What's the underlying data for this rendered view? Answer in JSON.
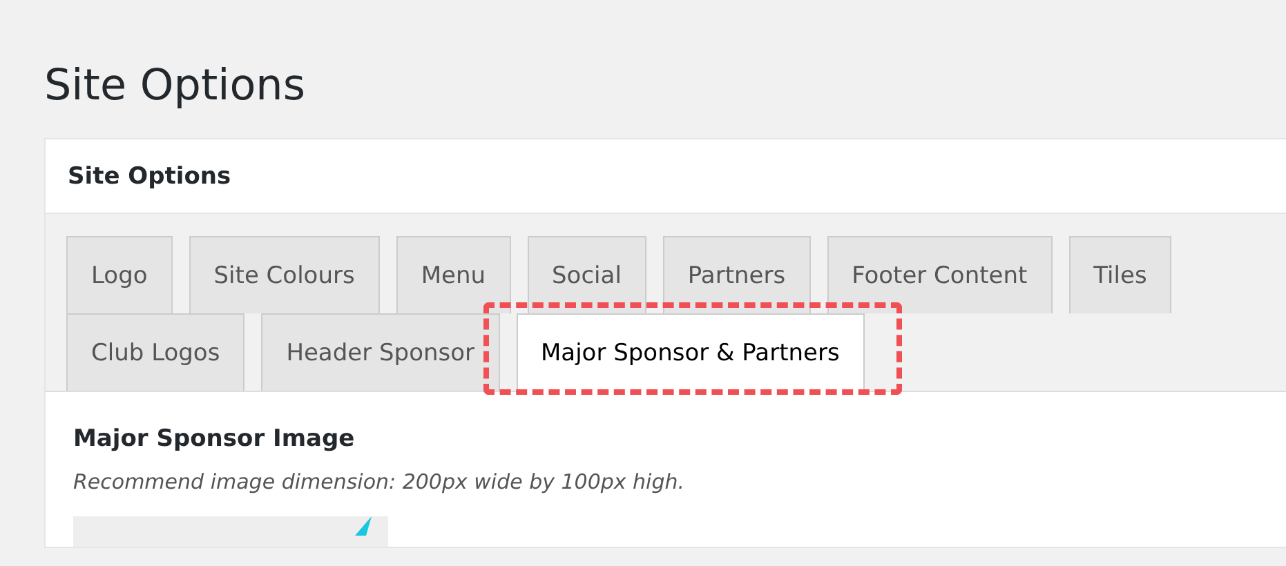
{
  "page_title": "Site Options",
  "panel": {
    "title": "Site Options",
    "tab_rows": [
      [
        {
          "label": "Logo",
          "selected": false
        },
        {
          "label": "Site Colours",
          "selected": false
        },
        {
          "label": "Menu",
          "selected": false
        },
        {
          "label": "Social",
          "selected": false
        },
        {
          "label": "Partners",
          "selected": false
        },
        {
          "label": "Footer Content",
          "selected": false
        },
        {
          "label": "Tiles",
          "selected": false
        }
      ],
      [
        {
          "label": "Club Logos",
          "selected": false
        },
        {
          "label": "Header Sponsor",
          "selected": false
        },
        {
          "label": "Major Sponsor & Partners",
          "selected": true,
          "highlighted": true
        }
      ]
    ],
    "field": {
      "label": "Major Sponsor Image",
      "description": "Recommend image dimension: 200px wide by 100px high."
    }
  }
}
